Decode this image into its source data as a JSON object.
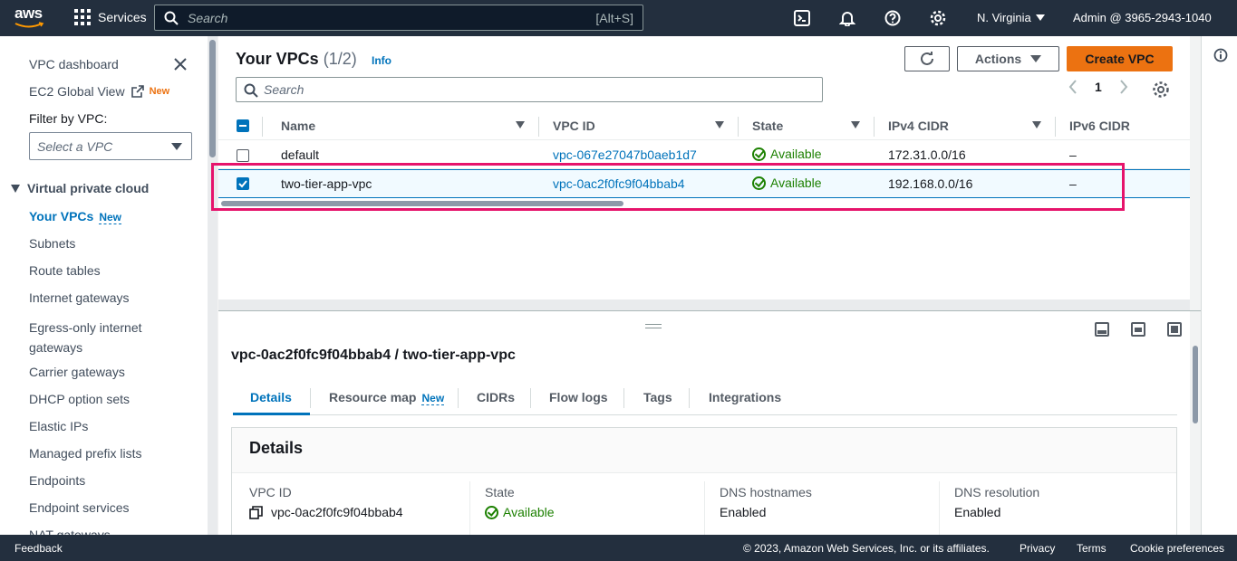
{
  "topbar": {
    "logo_text": "aws",
    "services_label": "Services",
    "search_placeholder": "Search",
    "search_shortcut": "[Alt+S]",
    "region": "N. Virginia",
    "account": "Admin @ 3965-2943-1040"
  },
  "sidebar": {
    "dashboard": "VPC dashboard",
    "global_view": "EC2 Global View",
    "global_view_badge": "New",
    "filter_label": "Filter by VPC:",
    "filter_placeholder": "Select a VPC",
    "section": "Virtual private cloud",
    "items": [
      {
        "label": "Your VPCs",
        "badge": "New",
        "active": true
      },
      {
        "label": "Subnets"
      },
      {
        "label": "Route tables"
      },
      {
        "label": "Internet gateways"
      },
      {
        "label": "Egress-only internet gateways"
      },
      {
        "label": "Carrier gateways"
      },
      {
        "label": "DHCP option sets"
      },
      {
        "label": "Elastic IPs"
      },
      {
        "label": "Managed prefix lists"
      },
      {
        "label": "Endpoints"
      },
      {
        "label": "Endpoint services"
      },
      {
        "label": "NAT gateways"
      }
    ]
  },
  "main": {
    "title": "Your VPCs",
    "count": "(1/2)",
    "info": "Info",
    "actions_label": "Actions",
    "create_label": "Create VPC",
    "search_placeholder": "Search",
    "page": "1",
    "columns": [
      "Name",
      "VPC ID",
      "State",
      "IPv4 CIDR",
      "IPv6 CIDR"
    ],
    "rows": [
      {
        "name": "default",
        "vpc_id": "vpc-067e27047b0aeb1d7",
        "state": "Available",
        "ipv4": "172.31.0.0/16",
        "ipv6": "–",
        "selected": false
      },
      {
        "name": "two-tier-app-vpc",
        "vpc_id": "vpc-0ac2f0fc9f04bbab4",
        "state": "Available",
        "ipv4": "192.168.0.0/16",
        "ipv6": "–",
        "selected": true
      }
    ]
  },
  "detail": {
    "title": "vpc-0ac2f0fc9f04bbab4 / two-tier-app-vpc",
    "tabs": [
      "Details",
      "Resource map",
      "CIDRs",
      "Flow logs",
      "Tags",
      "Integrations"
    ],
    "resource_map_badge": "New",
    "active_tab": "Details",
    "card_title": "Details",
    "fields": [
      {
        "key": "VPC ID",
        "value": "vpc-0ac2f0fc9f04bbab4"
      },
      {
        "key": "State",
        "value": "Available"
      },
      {
        "key": "DNS hostnames",
        "value": "Enabled"
      },
      {
        "key": "DNS resolution",
        "value": "Enabled"
      }
    ]
  },
  "footer": {
    "feedback": "Feedback",
    "copyright": "© 2023, Amazon Web Services, Inc. or its affiliates.",
    "privacy": "Privacy",
    "terms": "Terms",
    "cookies": "Cookie preferences"
  },
  "colors": {
    "accent": "#0073bb",
    "primary_button": "#ec7211",
    "highlight": "#e6136b",
    "success": "#1d8102",
    "topbar": "#232f3e"
  }
}
